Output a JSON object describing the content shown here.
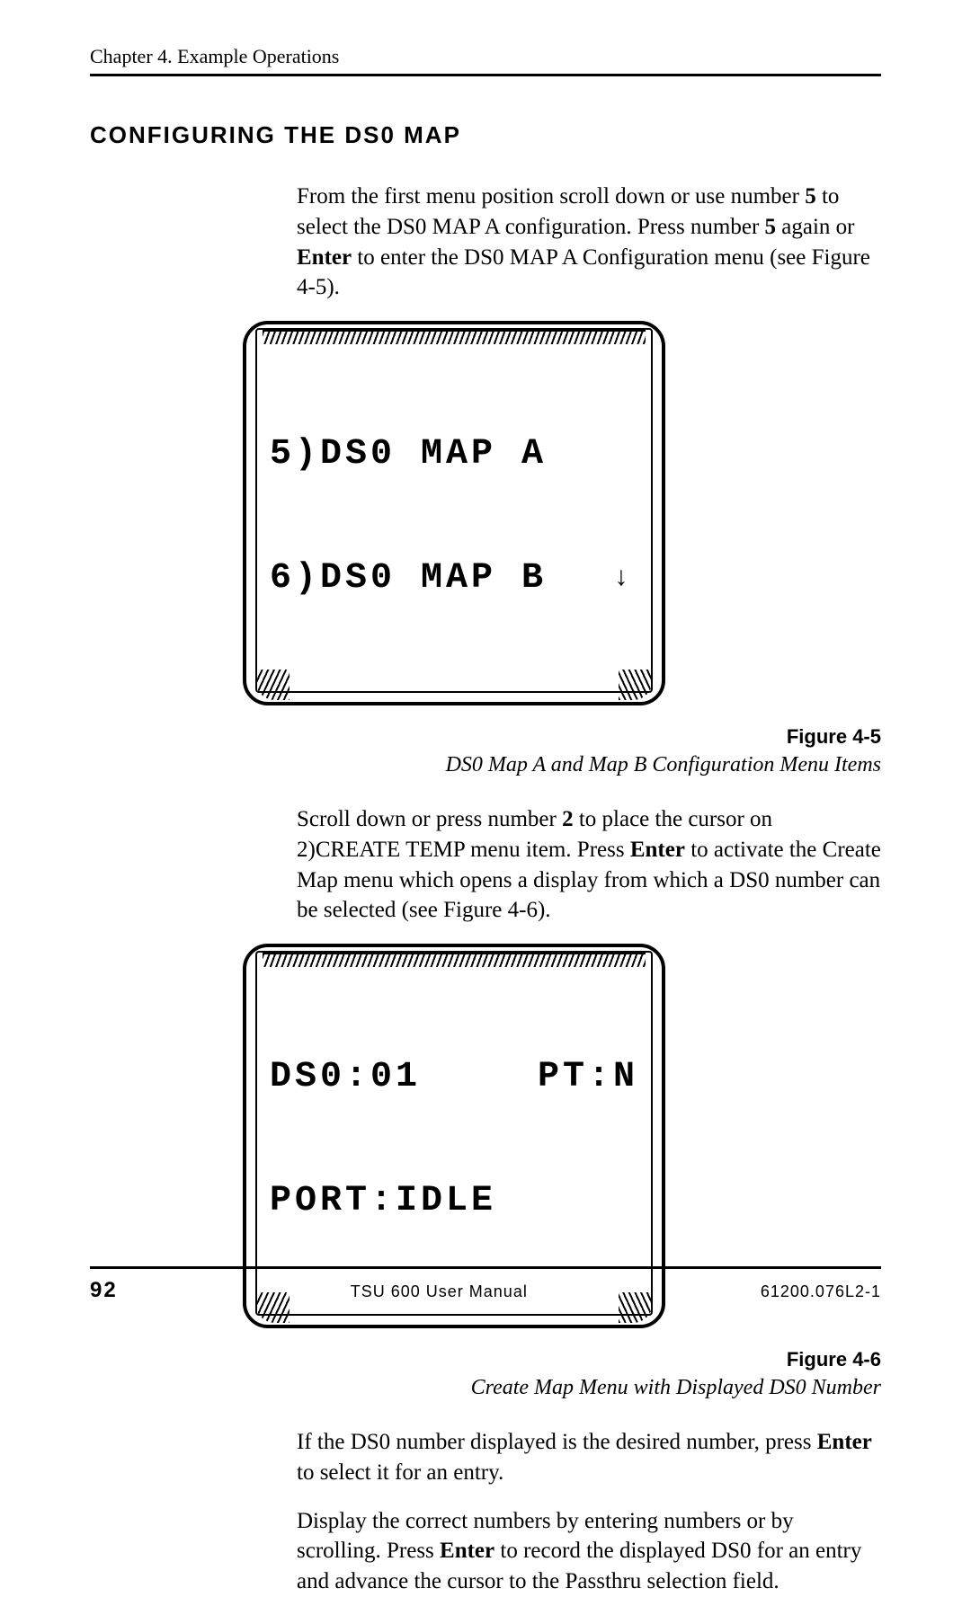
{
  "header": {
    "chapter": "Chapter 4.  Example Operations"
  },
  "section": {
    "title": "CONFIGURING THE DS0 MAP"
  },
  "para1_a": "From the first menu position scroll down or use number ",
  "para1_b": "5",
  "para1_c": " to select the DS0 MAP A configuration.  Press number ",
  "para1_d": "5",
  "para1_e": " again or ",
  "para1_f": "Enter",
  "para1_g": " to enter the DS0 MAP A Configuration menu (see Figure 4-5).",
  "lcd1": {
    "line1_left": "5)DS0 MAP A",
    "line2_left": "6)DS0 MAP B",
    "arrow": "↓"
  },
  "fig1": {
    "label": "Figure 4-5",
    "caption": "DS0 Map A and Map B Configuration Menu Items"
  },
  "para2_a": "Scroll down or press number ",
  "para2_b": "2",
  "para2_c": " to place the cursor on 2)CREATE TEMP menu item.  Press ",
  "para2_d": "Enter",
  "para2_e": " to activate the Create Map menu which opens a display from which a DS0 number can be selected (see Figure 4-6).",
  "lcd2": {
    "line1_left": "DS0:01",
    "line1_right": "PT:N",
    "line2_left": "PORT:IDLE"
  },
  "fig2": {
    "label": "Figure 4-6",
    "caption": "Create Map Menu with Displayed DS0 Number"
  },
  "para3_a": "If the DS0 number displayed is the desired number, press ",
  "para3_b": "Enter",
  "para3_c": " to select it for an entry.",
  "para4_a": "Display the correct numbers by entering numbers or by scrolling.  Press ",
  "para4_b": "Enter",
  "para4_c": " to record the displayed DS0 for an entry and advance the cursor to the Passthru selection field.",
  "footer": {
    "page": "92",
    "manual": "TSU 600 User Manual",
    "docnum": "61200.076L2-1"
  }
}
